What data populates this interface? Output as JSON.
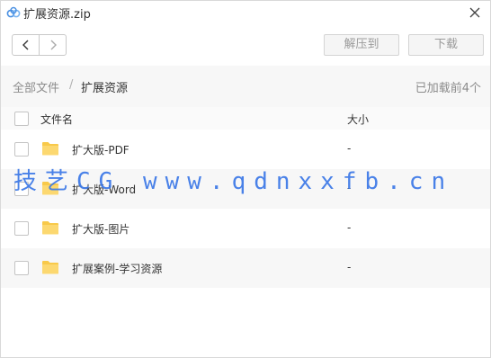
{
  "window": {
    "title": "扩展资源.zip"
  },
  "toolbar": {
    "extract_label": "解压到",
    "download_label": "下载"
  },
  "breadcrumb": {
    "root": "全部文件",
    "separator": "/",
    "current": "扩展资源"
  },
  "status": {
    "load_text": "已加载前4个"
  },
  "table": {
    "columns": {
      "name": "文件名",
      "size": "大小"
    },
    "rows": [
      {
        "name": "扩大版-PDF",
        "size": "-"
      },
      {
        "name": "扩大版-Word",
        "size": "-"
      },
      {
        "name": "扩大版-图片",
        "size": "-"
      },
      {
        "name": "扩展案例-学习资源",
        "size": "-"
      }
    ]
  },
  "watermark": {
    "text": "技艺CG www.qdnxxfb.cn"
  },
  "icons": {
    "app": "cloud-logo-icon",
    "close": "close-icon",
    "back": "chevron-left-icon",
    "forward": "chevron-right-icon",
    "folder": "folder-icon"
  },
  "colors": {
    "watermark": "#3b78e7",
    "folder": "#f8c94a",
    "brand": "#4a90e2"
  }
}
